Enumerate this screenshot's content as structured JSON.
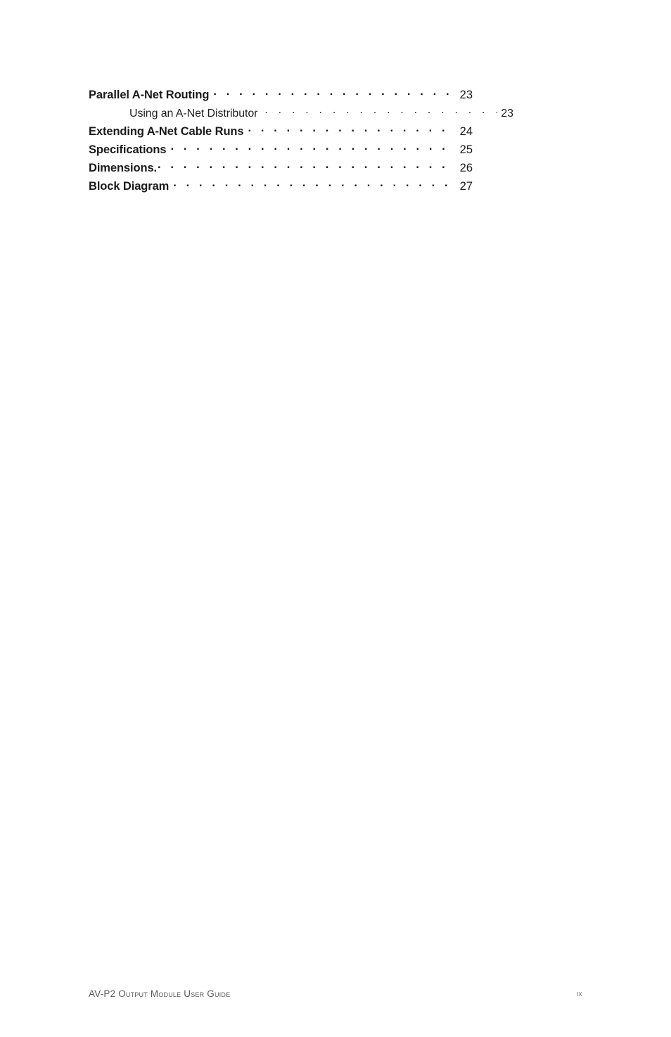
{
  "page": {
    "background": "#ffffff",
    "text_color": "#1a1a1a",
    "footer_color": "#5a5a5a"
  },
  "toc": {
    "entries": [
      {
        "title": "Parallel A-Net Routing",
        "page": "23",
        "level": 1
      },
      {
        "title": "Using an A-Net Distributor",
        "page": "23",
        "level": 2
      },
      {
        "title": "Extending A-Net Cable Runs",
        "page": "24",
        "level": 1
      },
      {
        "title": "Specifications",
        "page": "25",
        "level": 1
      },
      {
        "title": "Dimensions.",
        "page": "26",
        "level": 1
      },
      {
        "title": "Block Diagram",
        "page": "27",
        "level": 1
      }
    ]
  },
  "footer": {
    "title": "AV-P2 Output Module User Guide",
    "page_number": "ix"
  }
}
